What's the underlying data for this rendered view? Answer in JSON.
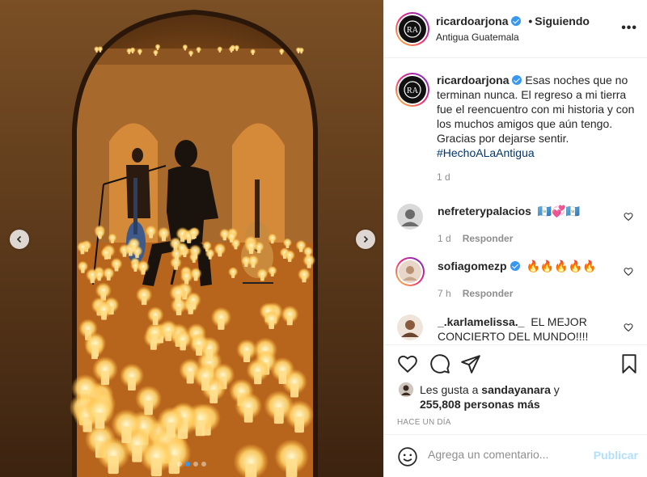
{
  "post": {
    "username": "ricardoarjona",
    "separator": "•",
    "follow_status": "Siguiendo",
    "location": "Antigua Guatemala",
    "more_icon": "more-options-icon"
  },
  "caption": {
    "username": "ricardoarjona",
    "text": "Esas noches que no terminan nunca. El regreso a mi tierra fue el reencuentro con mi historia y con los muchos amigos que aún tengo. Gracias por dejarse sentir.",
    "hashtag": "#HechoALaAntigua",
    "time": "1 d"
  },
  "comments": [
    {
      "username": "nefreterypalacios",
      "text": "🇬🇹💞🇬🇹",
      "time": "1 d",
      "reply": "Responder"
    },
    {
      "username": "sofiagomezp",
      "text": "🔥🔥🔥🔥🔥",
      "time": "7 h",
      "reply": "Responder"
    },
    {
      "username": "_.karlamelissa._",
      "text": "EL MEJOR CONCIERTO DEL MUNDO!!!!"
    }
  ],
  "likes": {
    "prefix": "Les gusta a",
    "user": "sandayanara",
    "conj": "y",
    "count": "255,808 personas más"
  },
  "timestamp": "HACE UN DÍA",
  "comment_box": {
    "placeholder": "Agrega un comentario...",
    "publish": "Publicar"
  },
  "carousel": {
    "total": 4,
    "active": 1
  },
  "colors": {
    "accent": "#3897f0",
    "hashtag": "#00376b",
    "muted": "#8e8e8e",
    "publish_disabled": "#b2dffc"
  }
}
